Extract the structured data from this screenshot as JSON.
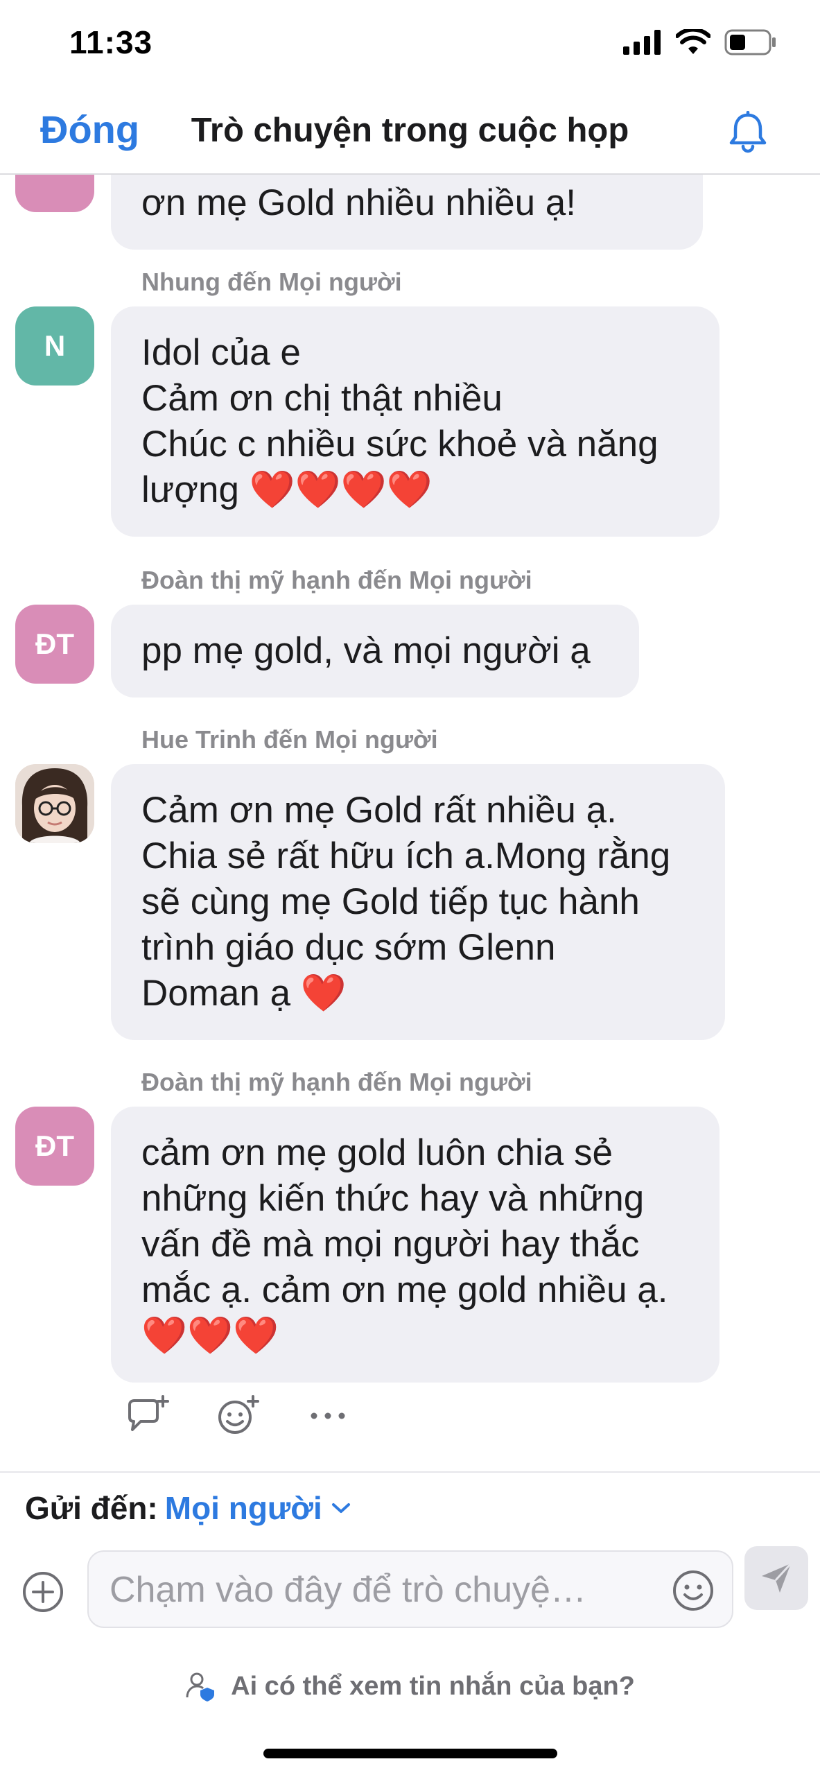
{
  "status_bar": {
    "time": "11:33"
  },
  "header": {
    "close_label": "Đóng",
    "title": "Trò chuyện trong cuộc họp"
  },
  "messages": [
    {
      "text": "ơn mẹ Gold nhiều nhiều ạ!"
    },
    {
      "sender": "Nhung đến Mọi người",
      "avatar_initials": "N",
      "text": "Idol của e\nCảm ơn chị thật nhiều\nChúc c nhiều sức khoẻ và năng lượng ❤️❤️❤️❤️"
    },
    {
      "sender": "Đoàn thị mỹ hạnh đến Mọi người",
      "avatar_initials": "ĐT",
      "text": "pp mẹ gold, và mọi người ạ"
    },
    {
      "sender": "Hue Trinh đến Mọi người",
      "text": "Cảm ơn mẹ Gold rất nhiều  ạ.\nChia sẻ rất hữu ích a.Mong rằng\nsẽ cùng mẹ Gold tiếp tục hành\ntrình giáo dục sớm Glenn\nDoman ạ ❤️"
    },
    {
      "sender": "Đoàn thị mỹ hạnh đến Mọi người",
      "avatar_initials": "ĐT",
      "text": "cảm ơn mẹ gold luôn chia sẻ\nnhững kiến thức hay và những\nvấn đề mà mọi người hay thắc\nmắc ạ. cảm ơn mẹ gold nhiều ạ.\n❤️❤️❤️"
    }
  ],
  "composer": {
    "send_to_label": "Gửi đến:",
    "send_to_value": "Mọi người",
    "placeholder": "Chạm vào đây để trò chuyệ…",
    "privacy_text": "Ai có thể xem tin nhắn của bạn?"
  },
  "colors": {
    "accent": "#2d7ae0",
    "bubble": "#efeff4",
    "teal_avatar": "#62b7a7",
    "pink_avatar": "#d98db7"
  },
  "icons": [
    "signal-icon",
    "wifi-icon",
    "battery-icon",
    "bell-icon",
    "reply-icon",
    "add-reaction-icon",
    "more-icon",
    "chevron-down-icon",
    "plus-circle-icon",
    "emoji-icon",
    "send-icon",
    "privacy-icon"
  ]
}
